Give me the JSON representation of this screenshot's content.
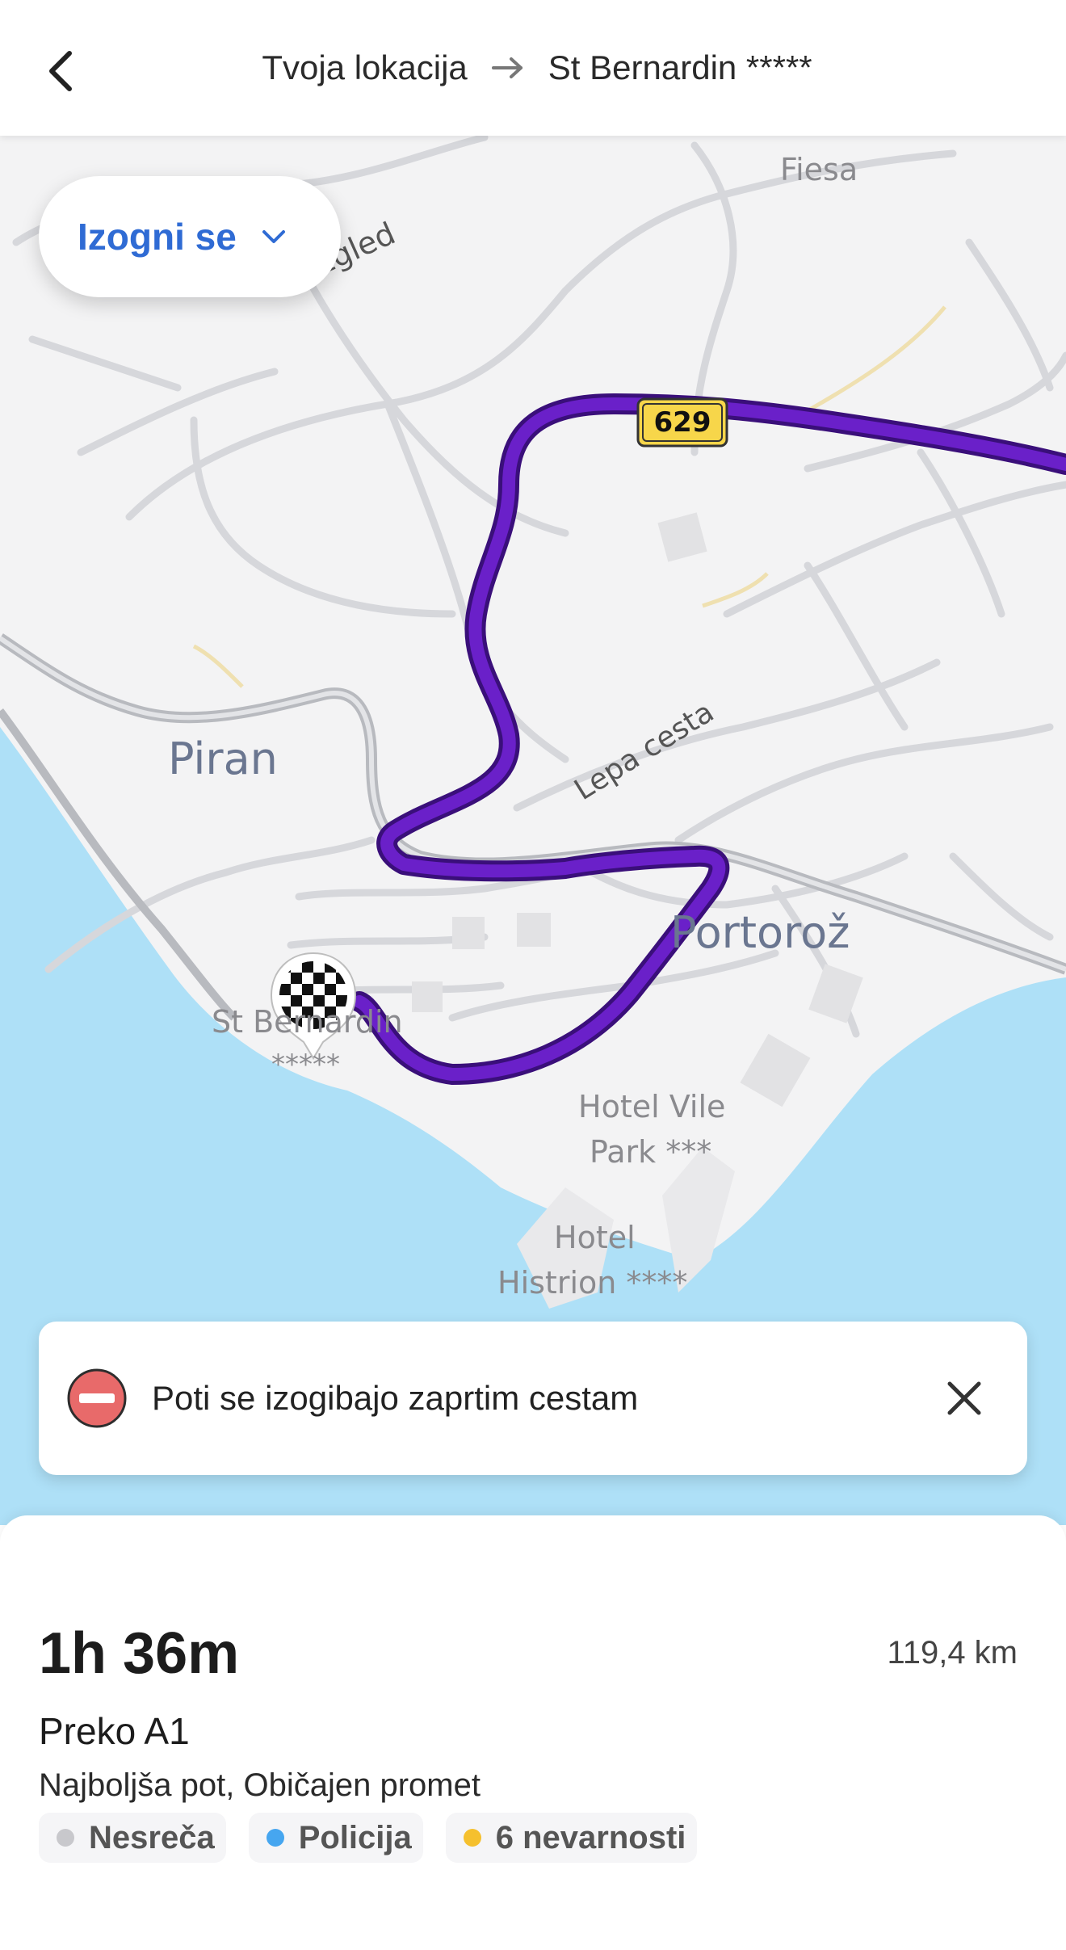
{
  "header": {
    "origin": "Tvoja lokacija",
    "destination": "St Bernardin *****",
    "back_icon": "chevron-left-icon",
    "arrow_icon": "arrow-right-icon"
  },
  "avoid": {
    "label": "Izogni se",
    "icon": "chevron-down-icon",
    "color": "#2f6bd4"
  },
  "map": {
    "road_shield": "629",
    "labels": {
      "piran": "Piran",
      "portoroz": "Portorož",
      "lepa_cesta": "Lepa cesta",
      "razgled": "Razgled",
      "fiesa": "Fiesa",
      "hotel_vile_1": "Hotel Vile",
      "hotel_vile_2": "Park ***",
      "hotel_histrion_1": "Hotel",
      "hotel_histrion_2": "Histrion ****",
      "st_bernardin_1": "St Bernardin",
      "st_bernardin_2": "*****"
    },
    "route_color": "#6a20c9",
    "water_color": "#aee0f7",
    "destination_icon": "checkered-flag-icon"
  },
  "notice": {
    "text": "Poti se izogibajo zaprtim cestam",
    "icon": "no-entry-icon",
    "close_icon": "close-icon"
  },
  "route": {
    "duration": "1h 36m",
    "distance": "119,4 km",
    "via": "Preko A1",
    "description": "Najboljša pot, Običajen promet"
  },
  "chips": [
    {
      "label": "Nesreča",
      "color": "#c8c8cc"
    },
    {
      "label": "Policija",
      "color": "#46a6f0"
    },
    {
      "label": "6 nevarnosti",
      "color": "#f5c02e"
    }
  ]
}
